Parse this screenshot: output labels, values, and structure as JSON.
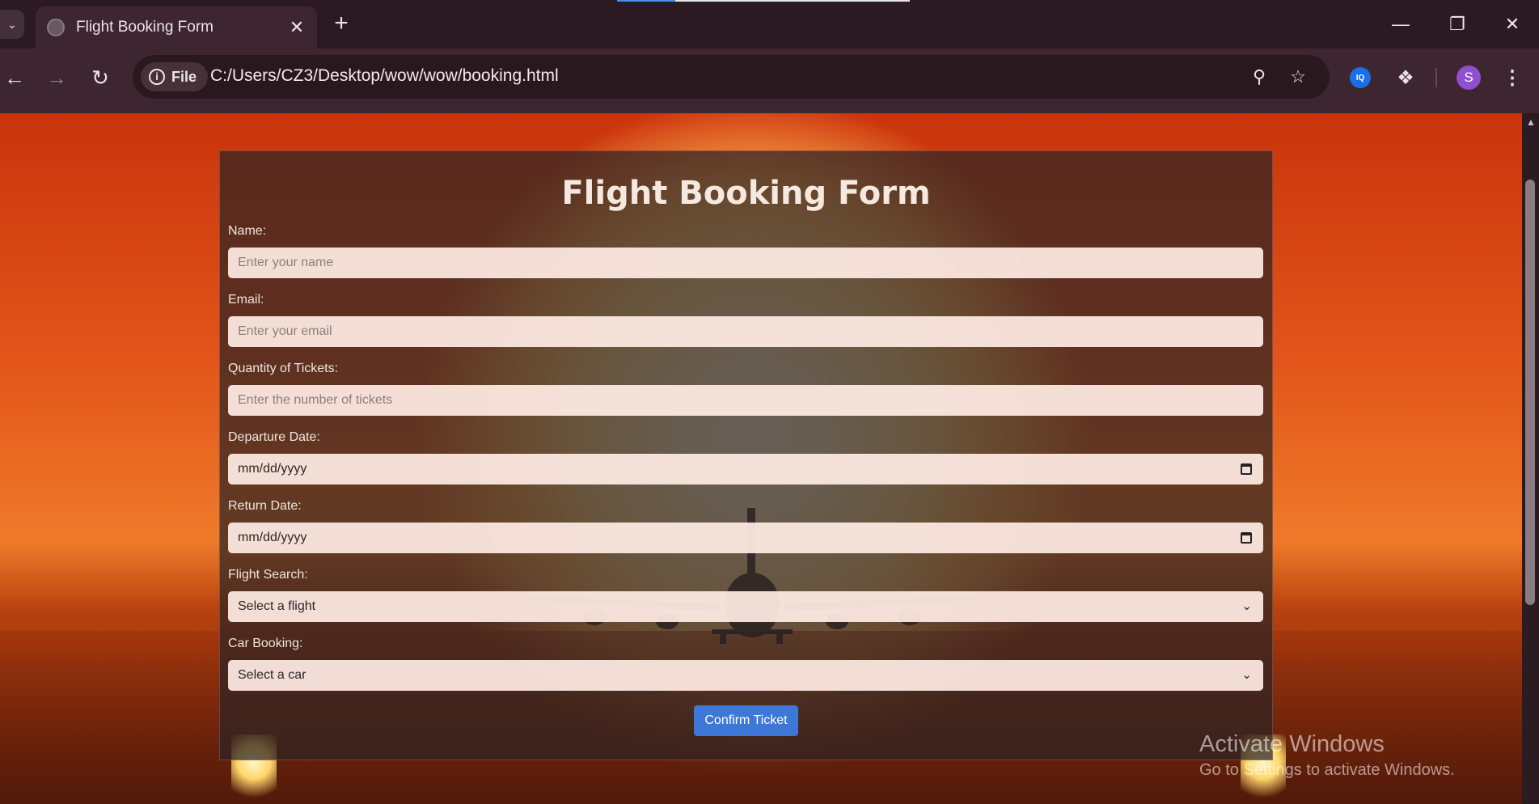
{
  "browser": {
    "tab_title": "Flight Booking Form",
    "url_chip": "File",
    "url": "C:/Users/CZ3/Desktop/wow/wow/booking.html",
    "profile_initial": "S",
    "ext_label": "IQ"
  },
  "form": {
    "title": "Flight Booking Form",
    "fields": [
      {
        "label": "Name:",
        "placeholder": "Enter your name"
      },
      {
        "label": "Email:",
        "placeholder": "Enter your email"
      },
      {
        "label": "Quantity of Tickets:",
        "placeholder": "Enter the number of tickets"
      },
      {
        "label": "Departure Date:",
        "value": "mm/dd/yyyy"
      },
      {
        "label": "Return Date:",
        "value": "mm/dd/yyyy"
      },
      {
        "label": "Flight Search:",
        "value": "Select a flight"
      },
      {
        "label": "Car Booking:",
        "value": "Select a car"
      }
    ],
    "submit_label": "Confirm Ticket"
  },
  "watermark": {
    "line1": "Activate Windows",
    "line2": "Go to Settings to activate Windows."
  },
  "icons": {
    "back": "arrow-left-icon",
    "forward": "arrow-right-icon",
    "reload": "reload-icon",
    "zoom": "zoom-icon",
    "bookmark": "star-icon",
    "extensions": "puzzle-icon",
    "menu": "kebab-menu-icon"
  }
}
